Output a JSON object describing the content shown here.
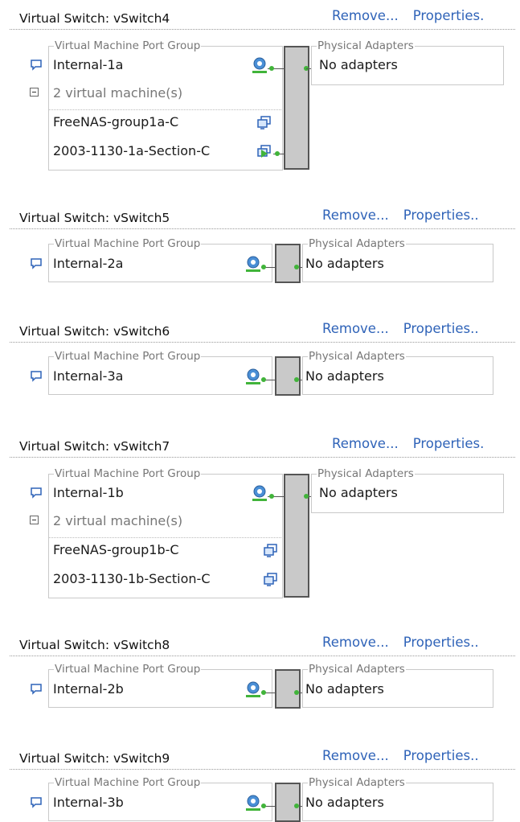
{
  "common": {
    "remove": "Remove...",
    "properties_full": "Properties.",
    "properties_dbl": "Properties..",
    "vm_group_legend": "Virtual Machine Port Group",
    "adapters_legend": "Physical Adapters",
    "no_adapters": "No adapters"
  },
  "switches": [
    {
      "title": "Virtual Switch: vSwitch4",
      "port_group": "Internal-1a",
      "vm_count": "2 virtual machine(s)",
      "vms": [
        "FreeNAS-group1a-C",
        "2003-1130-1a-Section-C"
      ]
    },
    {
      "title": "Virtual Switch: vSwitch5",
      "port_group": "Internal-2a"
    },
    {
      "title": "Virtual Switch: vSwitch6",
      "port_group": "Internal-3a"
    },
    {
      "title": "Virtual Switch: vSwitch7",
      "port_group": "Internal-1b",
      "vm_count": "2 virtual machine(s)",
      "vms": [
        "FreeNAS-group1b-C",
        "2003-1130-1b-Section-C"
      ]
    },
    {
      "title": "Virtual Switch: vSwitch8",
      "port_group": "Internal-2b"
    },
    {
      "title": "Virtual Switch: vSwitch9",
      "port_group": "Internal-3b"
    }
  ],
  "icons": {
    "port_group": "comment-icon",
    "expand": "minus-icon",
    "network": "network-adapter-icon",
    "vm": "virtual-machine-icon",
    "vm_running": "virtual-machine-running-icon"
  },
  "colors": {
    "link": "#2f63b8",
    "node": "#41b43a",
    "switch_fill": "#c9c9c9"
  }
}
